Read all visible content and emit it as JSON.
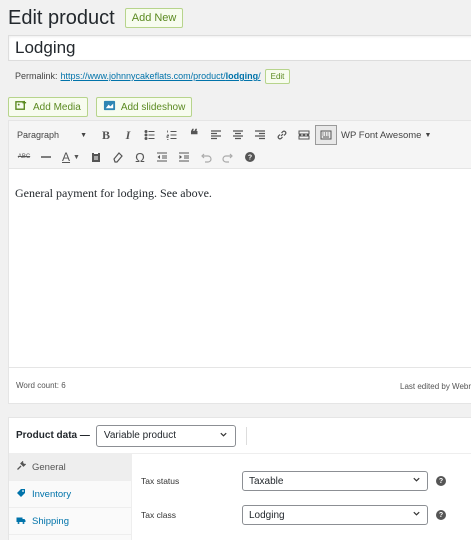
{
  "header": {
    "title": "Edit product",
    "add_new_label": "Add New"
  },
  "title_field": {
    "value": "Lodging"
  },
  "permalink": {
    "label": "Permalink:",
    "url_prefix": "https://www.johnnycakeflats.com/product/",
    "slug": "lodging",
    "url_suffix": "/",
    "edit_label": "Edit"
  },
  "media_buttons": {
    "add_media": "Add Media",
    "add_slideshow": "Add slideshow"
  },
  "toolbar": {
    "format_select": "Paragraph",
    "bold": "B",
    "italic": "I",
    "font_plugin": "WP Font Awesome",
    "strikethrough": "ABC",
    "text_color": "A",
    "special_char": "Ω"
  },
  "editor": {
    "content": "General payment for lodging. See above."
  },
  "status_bar": {
    "word_count": "Word count: 6",
    "last_edited": "Last edited by Webr"
  },
  "product_data": {
    "label": "Product data —",
    "type": "Variable product",
    "tabs": [
      {
        "label": "General",
        "icon": "wrench-icon",
        "active": true
      },
      {
        "label": "Inventory",
        "icon": "tag-icon",
        "active": false
      },
      {
        "label": "Shipping",
        "icon": "truck-icon",
        "active": false
      }
    ],
    "fields": [
      {
        "label": "Tax status",
        "value": "Taxable"
      },
      {
        "label": "Tax class",
        "value": "Lodging"
      }
    ]
  },
  "colors": {
    "link": "#0073aa",
    "accent_green": "#5b8a21",
    "accent_green_border": "#b7d48c"
  }
}
